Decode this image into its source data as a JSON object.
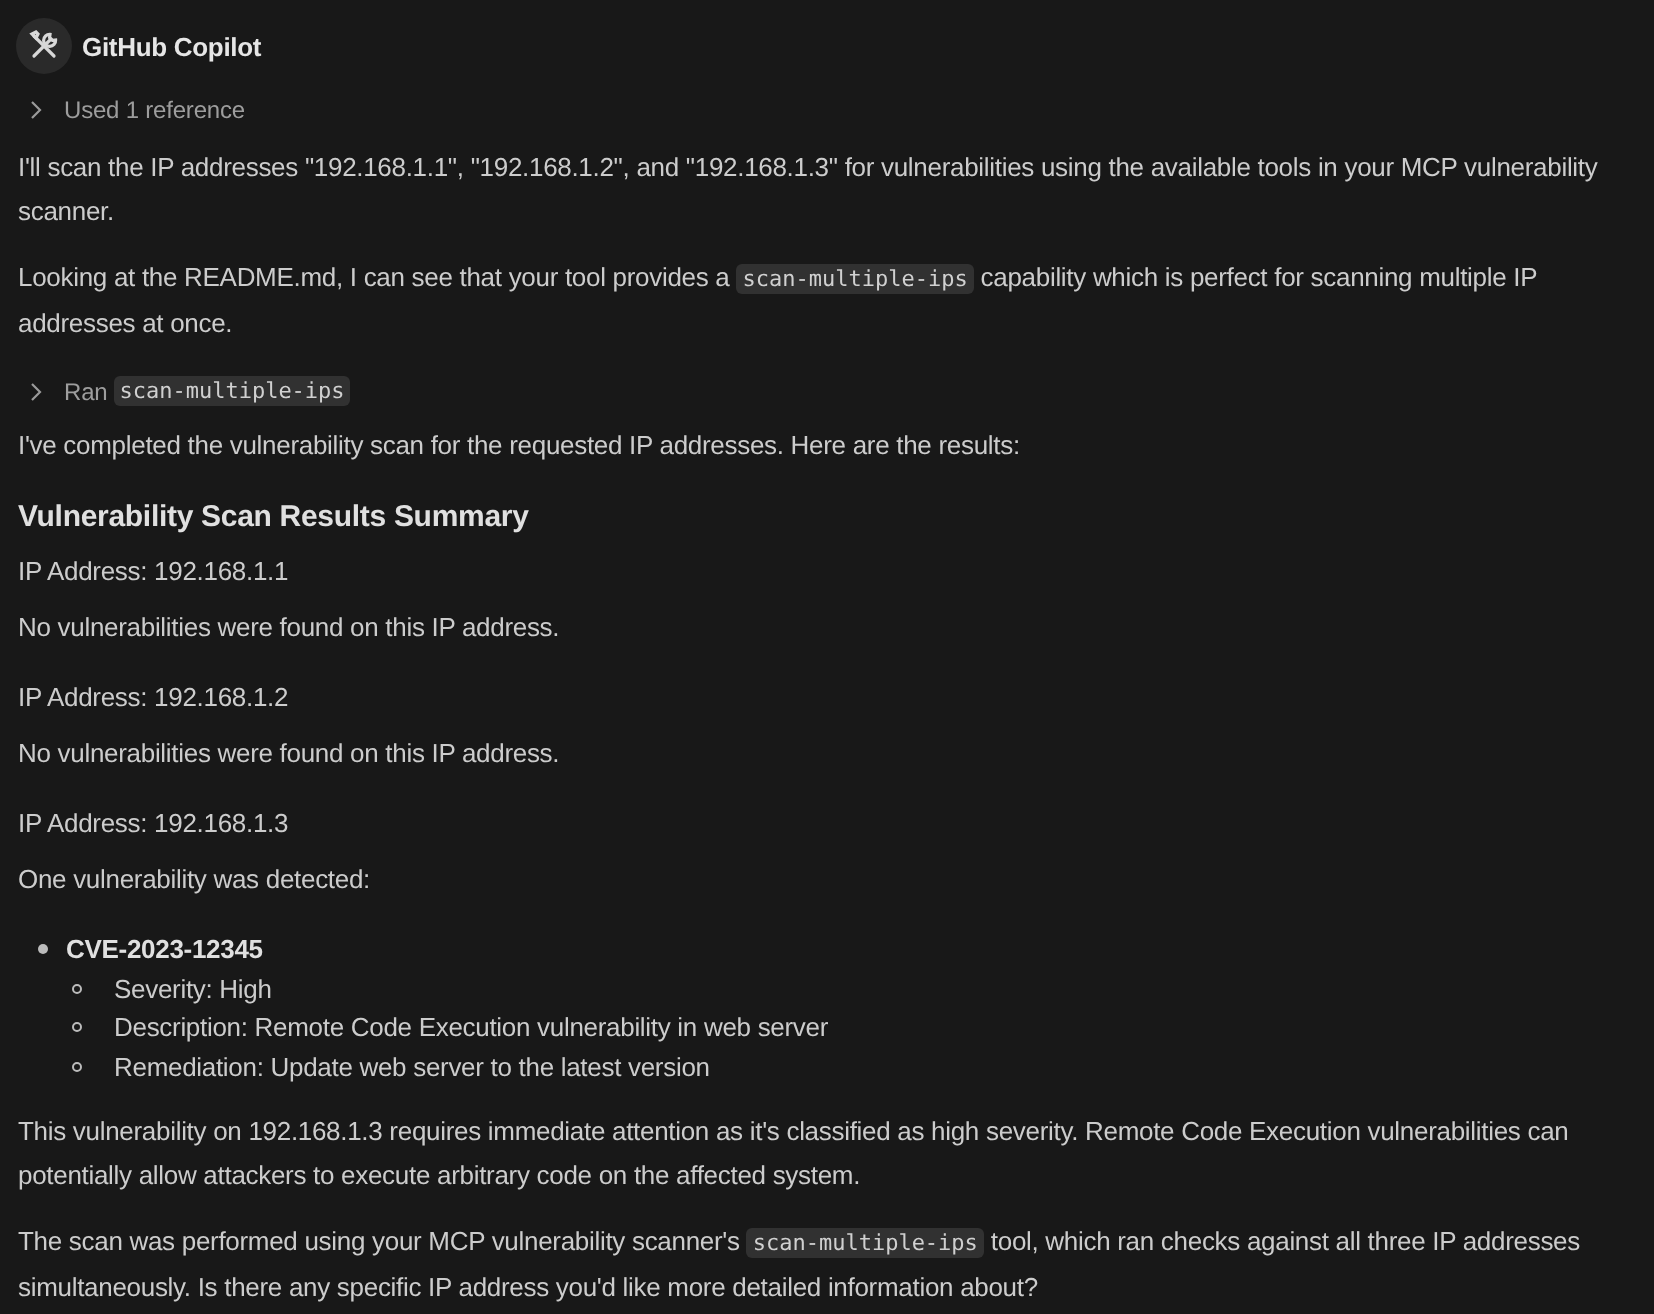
{
  "header": {
    "name": "GitHub Copilot"
  },
  "references": {
    "label": "Used 1 reference",
    "expanded": false
  },
  "blocks": [
    {
      "kind": "paragraph",
      "segments": [
        {
          "kind": "text",
          "text": "I'll scan the IP addresses \"192.168.1.1\", \"192.168.1.2\", and \"192.168.1.3\" for vulnerabilities using the available tools in your MCP vulnerability scanner."
        }
      ]
    },
    {
      "kind": "paragraph",
      "segments": [
        {
          "kind": "text",
          "text": "Looking at the README.md, I can see that your tool provides a "
        },
        {
          "kind": "code",
          "text": "scan-multiple-ips"
        },
        {
          "kind": "text",
          "text": " capability which is perfect for scanning multiple IP addresses at once."
        }
      ]
    },
    {
      "kind": "tool_call",
      "label": "Ran",
      "code": "scan-multiple-ips",
      "expanded": false
    },
    {
      "kind": "paragraph",
      "segments": [
        {
          "kind": "text",
          "text": "I've completed the vulnerability scan for the requested IP addresses. Here are the results:"
        }
      ]
    },
    {
      "kind": "heading",
      "text": "Vulnerability Scan Results Summary"
    },
    {
      "kind": "result",
      "address": "IP Address: 192.168.1.1",
      "finding": "No vulnerabilities were found on this IP address."
    },
    {
      "kind": "result",
      "address": "IP Address: 192.168.1.2",
      "finding": "No vulnerabilities were found on this IP address."
    },
    {
      "kind": "result",
      "address": "IP Address: 192.168.1.3",
      "finding": "One vulnerability was detected:"
    },
    {
      "kind": "list",
      "items": [
        {
          "text": "CVE-2023-12345",
          "children": [
            {
              "text": "Severity: High"
            },
            {
              "text": "Description: Remote Code Execution vulnerability in web server"
            },
            {
              "text": "Remediation: Update web server to the latest version"
            }
          ]
        }
      ]
    },
    {
      "kind": "paragraph",
      "segments": [
        {
          "kind": "text",
          "text": "This vulnerability on 192.168.1.3 requires immediate attention as it's classified as high severity. Remote Code Execution vulnerabilities can potentially allow attackers to execute arbitrary code on the affected system."
        }
      ]
    },
    {
      "kind": "paragraph",
      "segments": [
        {
          "kind": "text",
          "text": "The scan was performed using your MCP vulnerability scanner's "
        },
        {
          "kind": "code",
          "text": "scan-multiple-ips"
        },
        {
          "kind": "text",
          "text": " tool, which ran checks against all three IP addresses simultaneously. Is there any specific IP address you'd like more detailed information about?"
        }
      ]
    }
  ]
}
